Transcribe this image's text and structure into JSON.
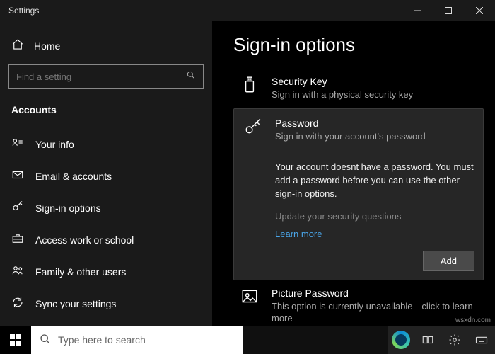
{
  "titlebar": {
    "app_name": "Settings"
  },
  "sidebar": {
    "home_label": "Home",
    "search_placeholder": "Find a setting",
    "section": "Accounts",
    "items": [
      {
        "label": "Your info"
      },
      {
        "label": "Email & accounts"
      },
      {
        "label": "Sign-in options"
      },
      {
        "label": "Access work or school"
      },
      {
        "label": "Family & other users"
      },
      {
        "label": "Sync your settings"
      }
    ]
  },
  "main": {
    "heading": "Sign-in options",
    "security_key": {
      "title": "Security Key",
      "desc": "Sign in with a physical security key"
    },
    "password": {
      "title": "Password",
      "desc": "Sign in with your account's password",
      "message": "Your account doesnt have a password. You must add a password before you can use the other sign-in options.",
      "update_questions": "Update your security questions",
      "learn_more": "Learn more",
      "add_button": "Add"
    },
    "picture_password": {
      "title": "Picture Password",
      "desc": "This option is currently unavailable—click to learn more"
    }
  },
  "taskbar": {
    "search_placeholder": "Type here to search"
  },
  "watermark": "wsxdn.com"
}
